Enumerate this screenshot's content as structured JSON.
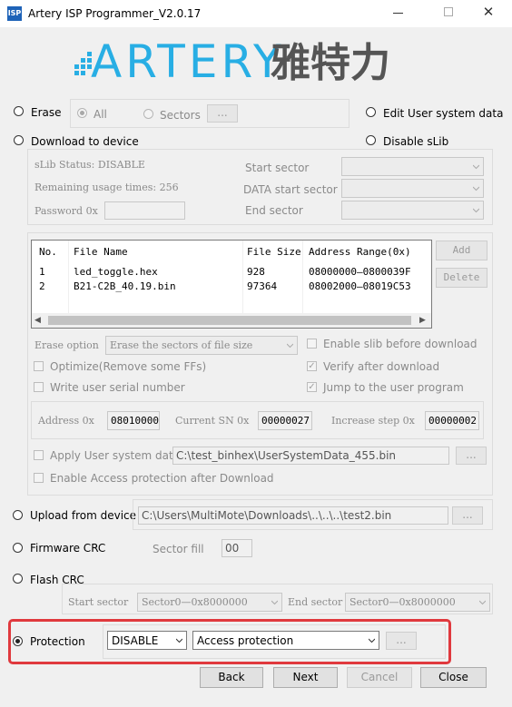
{
  "window": {
    "title": "Artery ISP Programmer_V2.0.17",
    "icon_text": "ISP"
  },
  "brand": {
    "logo_text": "ARTERY",
    "logo_cn": "雅特力",
    "logo_color": "#28aee4"
  },
  "erase": {
    "label": "Erase",
    "all": "All",
    "sectors": "Sectors",
    "dots": "..."
  },
  "edit_user": "Edit User system data",
  "download": {
    "label": "Download to device"
  },
  "disable_slib": "Disable sLib",
  "slib": {
    "status": "sLib Status: DISABLE",
    "remaining": "Remaining usage times: 256",
    "password": "Password  0x",
    "start_sector": "Start sector",
    "data_start_sector": "DATA start sector",
    "end_sector": "End sector"
  },
  "files": {
    "headers": [
      "No.",
      "File Name",
      "File Size",
      "Address Range(0x)"
    ],
    "rows": [
      [
        "1",
        "led_toggle.hex",
        "928",
        "08000000—0800039F"
      ],
      [
        "2",
        "B21-C2B_40.19.bin",
        "97364",
        "08002000—08019C53"
      ]
    ],
    "add": "Add",
    "delete": "Delete"
  },
  "options": {
    "erase_option_label": "Erase option",
    "erase_option_value": "Erase the sectors of file size",
    "enable_slib": "Enable slib before download",
    "optimize": "Optimize(Remove some FFs)",
    "verify": "Verify after download",
    "serial": "Write user serial number",
    "jump": "Jump to the user program"
  },
  "serial": {
    "address_label": "Address  0x",
    "address_value": "08010000",
    "current_label": "Current SN  0x",
    "current_value": "00000027",
    "step_label": "Increase step 0x",
    "step_value": "00000002"
  },
  "apply_user": {
    "label": "Apply User system data",
    "path": "C:\\test_binhex\\UserSystemData_455.bin",
    "dots": "..."
  },
  "enable_access": "Enable Access protection after Download",
  "upload": {
    "label": "Upload from device",
    "path": "C:\\Users\\MultiMote\\Downloads\\..\\..\\..\\test2.bin",
    "dots": "..."
  },
  "fw_crc": {
    "label": "Firmware CRC",
    "sector_fill": "Sector fill",
    "value": "00"
  },
  "flash_crc": {
    "label": "Flash CRC",
    "start_label": "Start sector",
    "start_value": "Sector0—0x8000000",
    "end_label": "End sector",
    "end_value": "Sector0—0x8000000"
  },
  "protection": {
    "label": "Protection",
    "mode": "DISABLE",
    "type": "Access protection",
    "dots": "...",
    "highlight_color": "#e0393e"
  },
  "footer": {
    "back": "Back",
    "next": "Next",
    "cancel": "Cancel",
    "close": "Close"
  }
}
